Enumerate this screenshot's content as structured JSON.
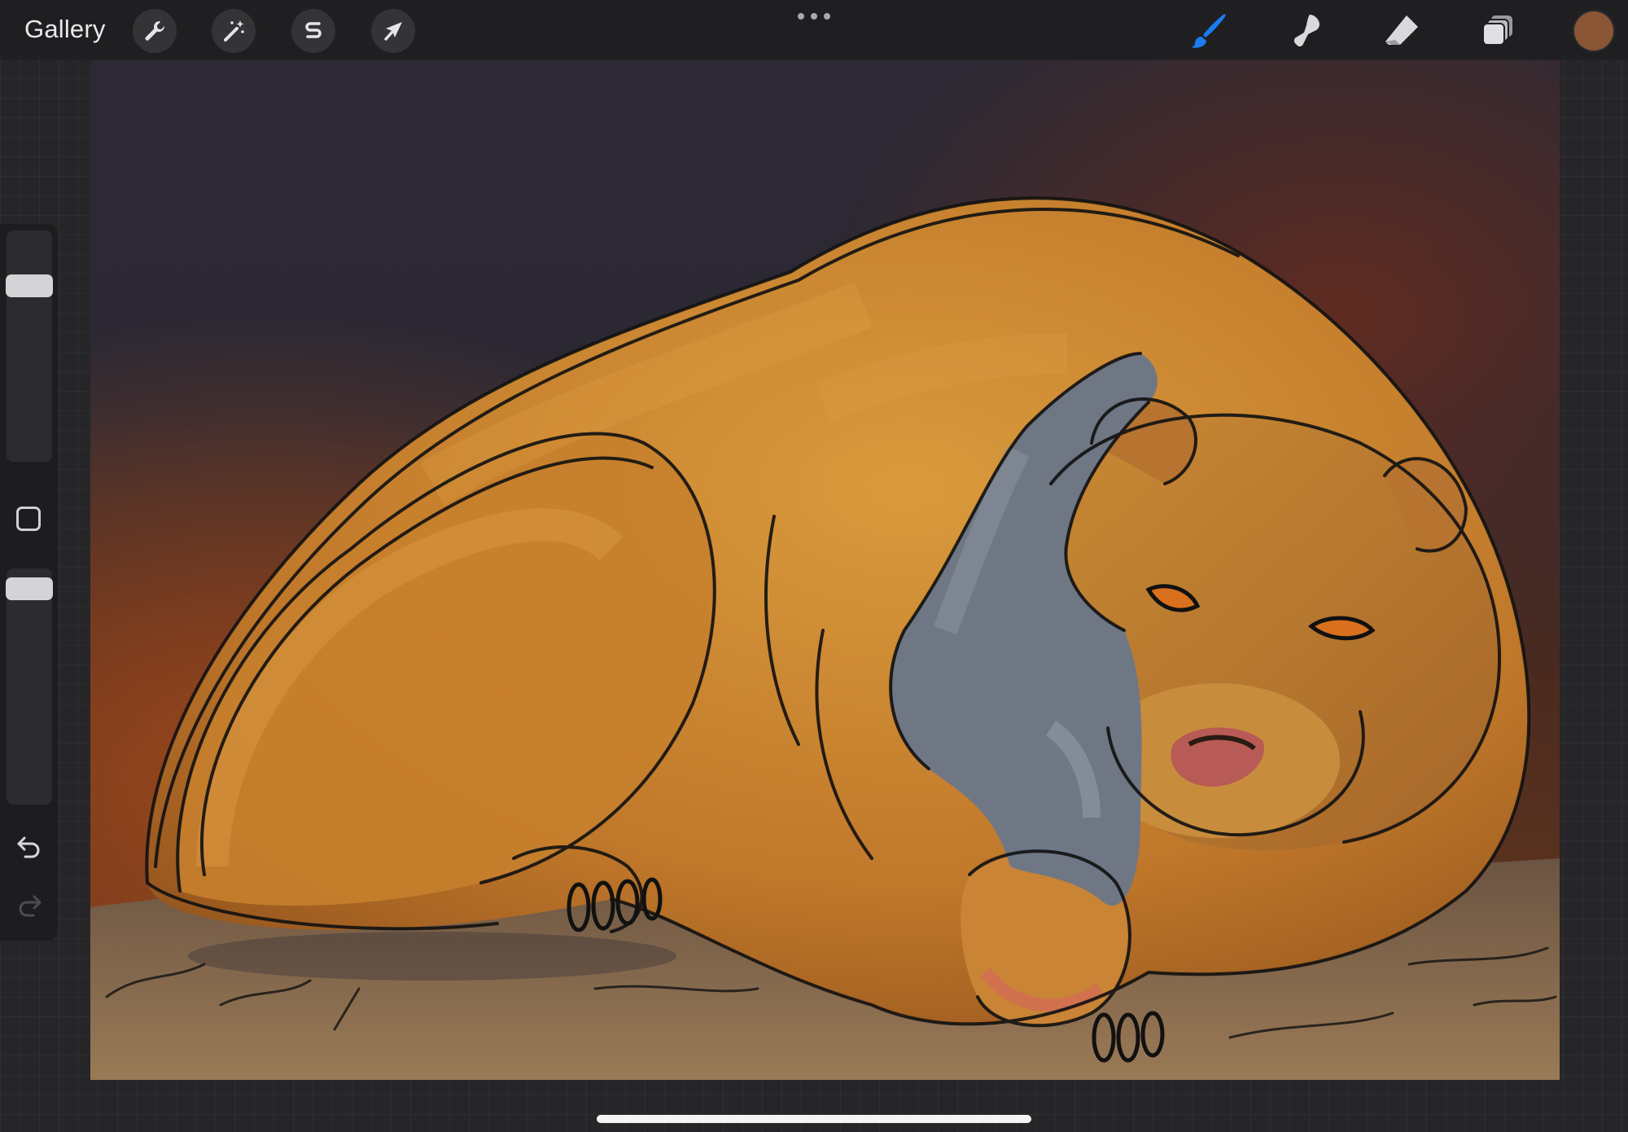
{
  "topbar": {
    "gallery_label": "Gallery",
    "left_tools": [
      {
        "icon": "wrench-icon",
        "name": "actions"
      },
      {
        "icon": "magic-wand-icon",
        "name": "adjustments"
      },
      {
        "icon": "selection-s-icon",
        "name": "selection"
      },
      {
        "icon": "arrow-cursor-icon",
        "name": "transform"
      }
    ],
    "more_icon": "ellipsis-icon",
    "right_tools": [
      {
        "icon": "brush-icon",
        "name": "brush",
        "active": true
      },
      {
        "icon": "smudge-icon",
        "name": "smudge",
        "active": false
      },
      {
        "icon": "eraser-icon",
        "name": "eraser",
        "active": false
      },
      {
        "icon": "layers-icon",
        "name": "layers",
        "active": false
      }
    ],
    "current_color": "#8a5636"
  },
  "sidebar": {
    "brush_size_icon": "size-slider",
    "opacity_icon": "opacity-slider",
    "modify_icon": "square-icon",
    "undo_icon": "undo-icon",
    "redo_icon": "redo-icon",
    "size_level": 0.1,
    "opacity_level": 0.0
  },
  "canvas": {
    "subject": "brown-bear-and-grey-wolf-painting",
    "colors": {
      "background_dark": "#2a2730",
      "glow": "#6b3418",
      "bear": "#c7832f",
      "wolf": "#6f7785",
      "ground": "#8a6c4f",
      "linework": "#111111"
    }
  },
  "accent_color": "#1a7cf5"
}
